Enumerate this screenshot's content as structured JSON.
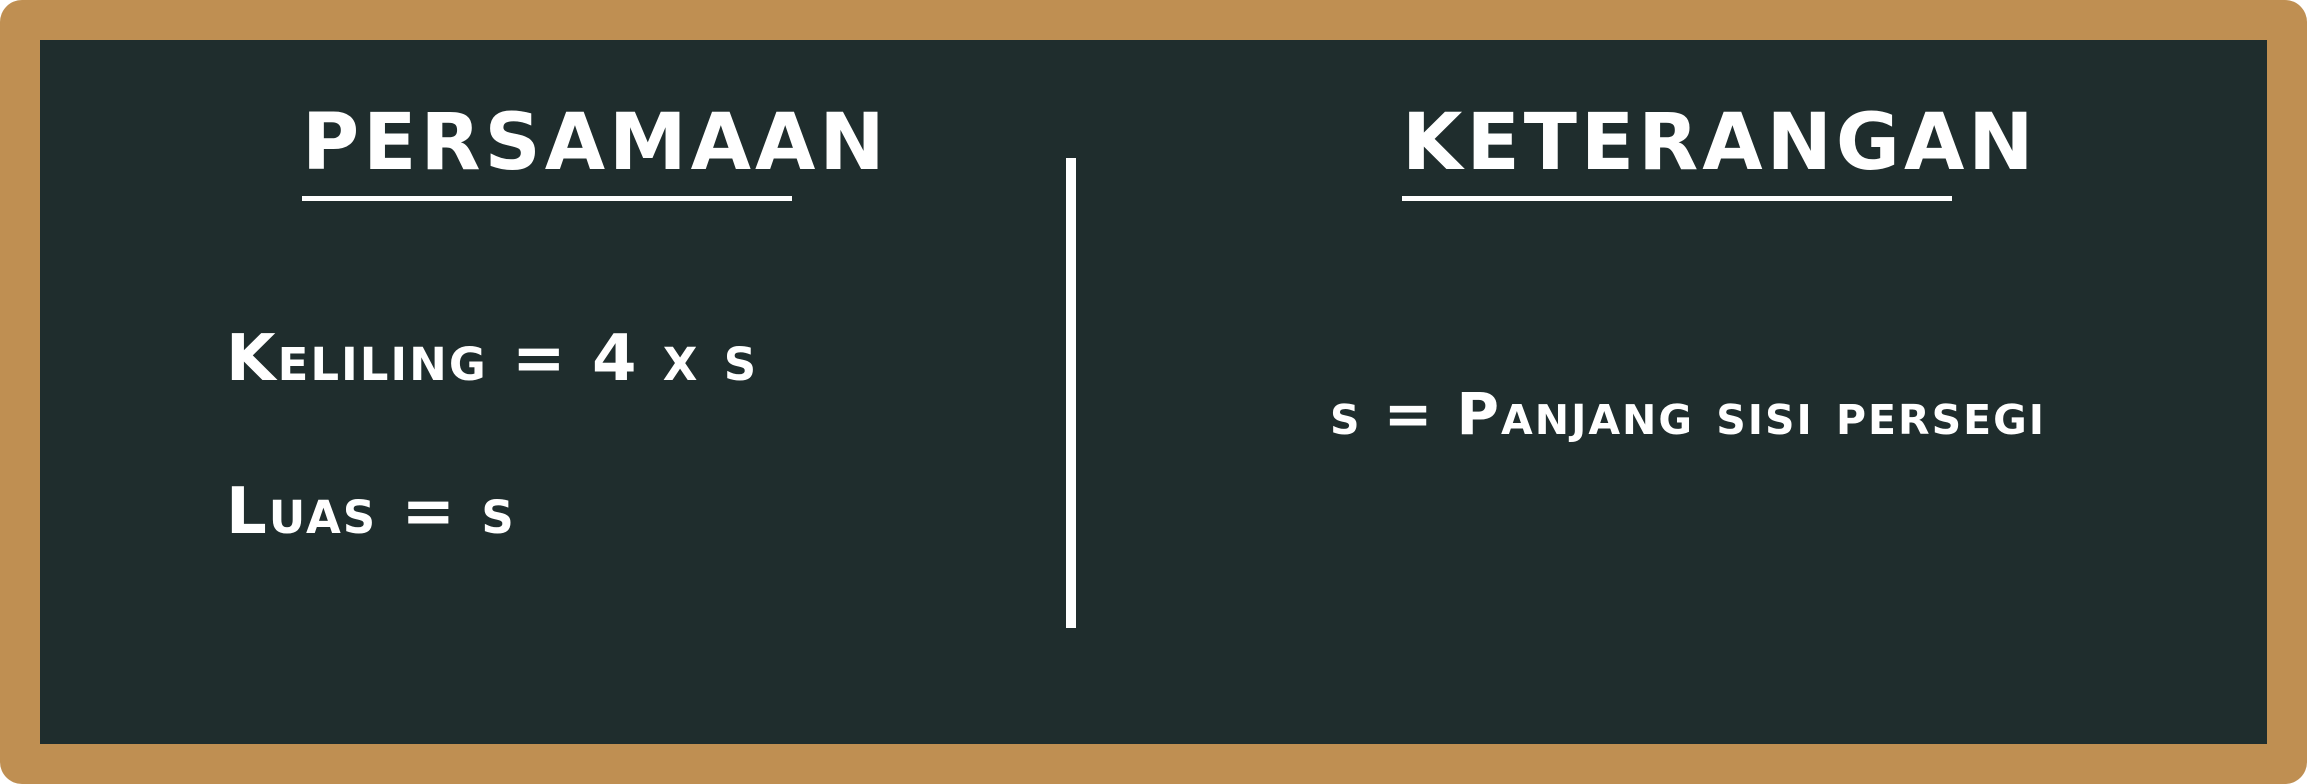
{
  "board": {
    "left_heading": "PERSAMAAN",
    "right_heading": "KETERANGAN"
  },
  "formulas": {
    "keliling": "Keliling = 4 x s",
    "luas": "Luas = s"
  },
  "notes": {
    "s_definition": "s = Panjang sisi persegi"
  },
  "colors": {
    "frame": "#bf8f52",
    "board": "#1f2d2d",
    "chalk": "#ffffff"
  }
}
